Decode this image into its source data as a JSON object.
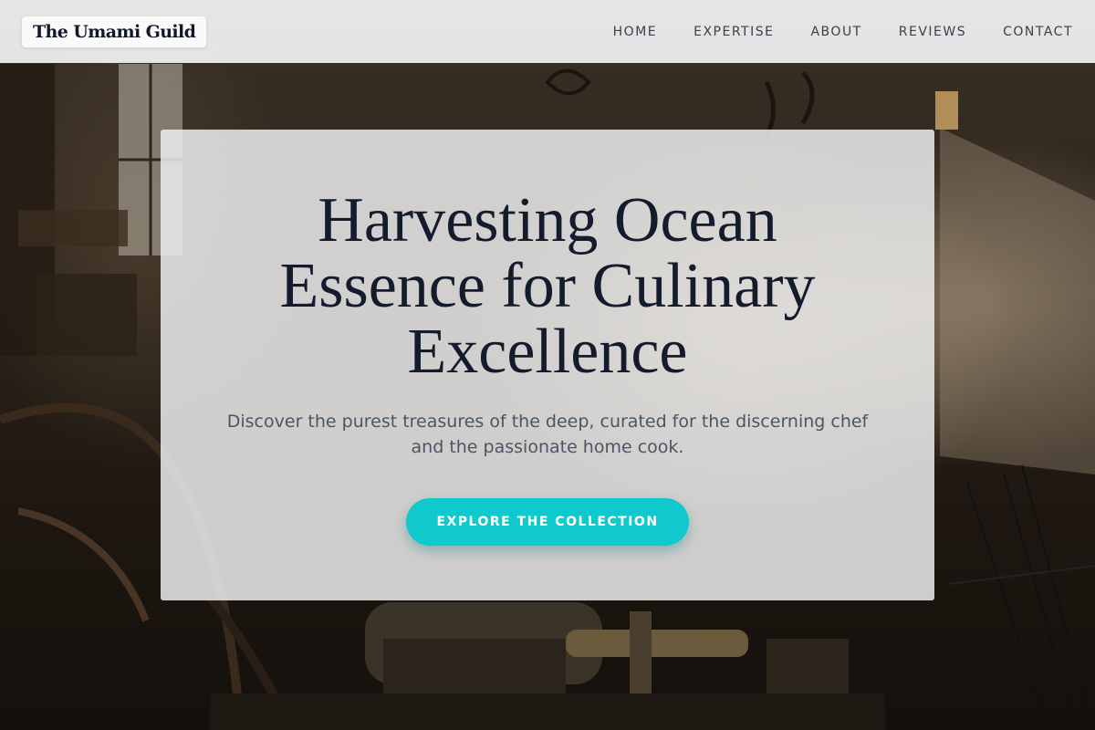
{
  "brand": {
    "name": "The Umami Guild"
  },
  "nav": {
    "items": [
      {
        "label": "HOME"
      },
      {
        "label": "EXPERTISE"
      },
      {
        "label": "ABOUT"
      },
      {
        "label": "REVIEWS"
      },
      {
        "label": "CONTACT"
      }
    ]
  },
  "hero": {
    "title": "Harvesting Ocean Essence for Culinary Excellence",
    "subtitle": "Discover the purest treasures of the deep, curated for the discerning chef and the passionate home cook.",
    "cta_label": "EXPLORE THE COLLECTION"
  },
  "colors": {
    "accent": "#0fc9cc",
    "title_text": "#141b2d",
    "body_text": "#4b5563",
    "navbar_bg": "#ececec"
  }
}
